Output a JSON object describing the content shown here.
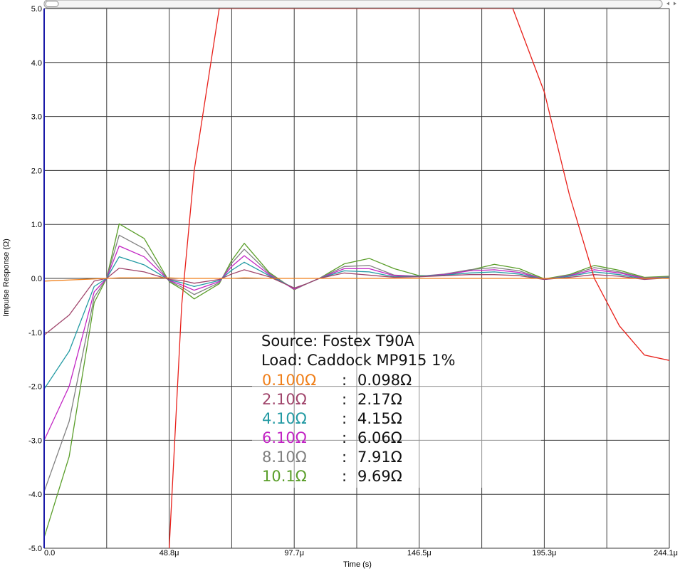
{
  "chart_data": {
    "type": "line",
    "xlabel": "Time (s)",
    "ylabel": "Impulse Response (Ω)",
    "xlim": [
      0,
      244.1
    ],
    "ylim": [
      -5.0,
      5.0
    ],
    "x_tick_labels": [
      "0.0",
      "48.8μ",
      "97.7μ",
      "146.5μ",
      "195.3μ",
      "244.1μ"
    ],
    "y_tick_labels": [
      "5.0",
      "4.0",
      "3.0",
      "2.0",
      "1.0",
      "0.0",
      "-1.0",
      "-2.0",
      "-3.0",
      "-4.0",
      "-5.0"
    ],
    "grid": true,
    "x": [
      0,
      9.77,
      19.53,
      24.4,
      29.3,
      39.06,
      48.83,
      53.7,
      58.59,
      68.36,
      73.2,
      78.13,
      87.89,
      97.66,
      102.5,
      107.42,
      117.19,
      126.95,
      136.72,
      146.48,
      156.25,
      166.02,
      175.78,
      185.55,
      195.31,
      205.08,
      214.84,
      224.61,
      234.38,
      244.1
    ],
    "series": [
      {
        "label": "0.100Ω",
        "value": "0.098Ω",
        "color": "#f07f19",
        "values": [
          -0.05,
          -0.03,
          -0.01,
          0.0,
          0.01,
          0.01,
          0.01,
          0.0,
          0.0,
          0.0,
          0.0,
          0.01,
          0.0,
          0.0,
          0.0,
          0.0,
          0.0,
          0.0,
          0.0,
          0.0,
          0.0,
          0.0,
          0.0,
          0.0,
          0.0,
          0.0,
          0.0,
          0.0,
          0.0,
          0.0
        ]
      },
      {
        "label": "2.10Ω",
        "value": "2.17Ω",
        "color": "#a0456b",
        "values": [
          -1.05,
          -0.68,
          -0.05,
          0.0,
          0.19,
          0.12,
          -0.02,
          -0.04,
          -0.09,
          -0.02,
          0.08,
          0.16,
          0.03,
          -0.18,
          -0.1,
          0.0,
          0.1,
          0.06,
          0.02,
          0.03,
          0.05,
          0.07,
          0.07,
          0.05,
          -0.02,
          0.02,
          0.07,
          0.04,
          -0.02,
          0.01
        ]
      },
      {
        "label": "4.10Ω",
        "value": "4.15Ω",
        "color": "#229aa3",
        "values": [
          -2.05,
          -1.35,
          -0.15,
          0.0,
          0.4,
          0.25,
          -0.03,
          -0.08,
          -0.15,
          -0.04,
          0.15,
          0.3,
          0.05,
          -0.18,
          -0.1,
          0.0,
          0.14,
          0.12,
          0.03,
          0.04,
          0.06,
          0.1,
          0.12,
          0.08,
          -0.02,
          0.04,
          0.12,
          0.07,
          -0.01,
          0.02
        ]
      },
      {
        "label": "6.10Ω",
        "value": "6.06Ω",
        "color": "#c224c4",
        "values": [
          -3.0,
          -2.0,
          -0.25,
          0.0,
          0.6,
          0.4,
          -0.04,
          -0.12,
          -0.22,
          -0.06,
          0.22,
          0.42,
          0.07,
          -0.2,
          -0.1,
          0.0,
          0.18,
          0.18,
          0.05,
          0.04,
          0.07,
          0.14,
          0.16,
          0.11,
          -0.02,
          0.05,
          0.16,
          0.1,
          0.0,
          0.02
        ]
      },
      {
        "label": "8.10Ω",
        "value": "7.91Ω",
        "color": "#808080",
        "values": [
          -3.95,
          -2.65,
          -0.35,
          0.0,
          0.8,
          0.55,
          -0.05,
          -0.16,
          -0.3,
          -0.08,
          0.28,
          0.54,
          0.09,
          -0.2,
          -0.1,
          0.0,
          0.22,
          0.24,
          0.06,
          0.04,
          0.08,
          0.16,
          0.2,
          0.14,
          -0.02,
          0.06,
          0.2,
          0.12,
          0.01,
          0.03
        ]
      },
      {
        "label": "10.1Ω",
        "value": "9.69Ω",
        "color": "#5a9e2a",
        "values": [
          -4.8,
          -3.3,
          -0.45,
          0.0,
          1.01,
          0.74,
          -0.06,
          -0.2,
          -0.38,
          -0.1,
          0.33,
          0.65,
          0.11,
          -0.21,
          -0.1,
          0.0,
          0.27,
          0.37,
          0.18,
          0.05,
          0.05,
          0.15,
          0.26,
          0.18,
          -0.01,
          0.07,
          0.24,
          0.15,
          0.02,
          0.04
        ]
      }
    ],
    "extra_series": {
      "color": "#e8201a",
      "points": [
        [
          48.83,
          -5.0
        ],
        [
          53.7,
          -0.5
        ],
        [
          58.59,
          2.0
        ],
        [
          68.36,
          5.0
        ],
        [
          183.0,
          5.0
        ],
        [
          195.31,
          3.45
        ],
        [
          205.08,
          1.55
        ],
        [
          214.84,
          0.0
        ],
        [
          224.61,
          -0.88
        ],
        [
          234.38,
          -1.42
        ],
        [
          244.1,
          -1.52
        ]
      ]
    },
    "annotation": {
      "source": "Source: Fostex T90A",
      "load": "Load: Caddock MP915 1%",
      "separator": ":"
    }
  },
  "colors": {
    "background": "#ffffff",
    "grid": "#3a3a3a",
    "axis": "#1a1aa8"
  }
}
